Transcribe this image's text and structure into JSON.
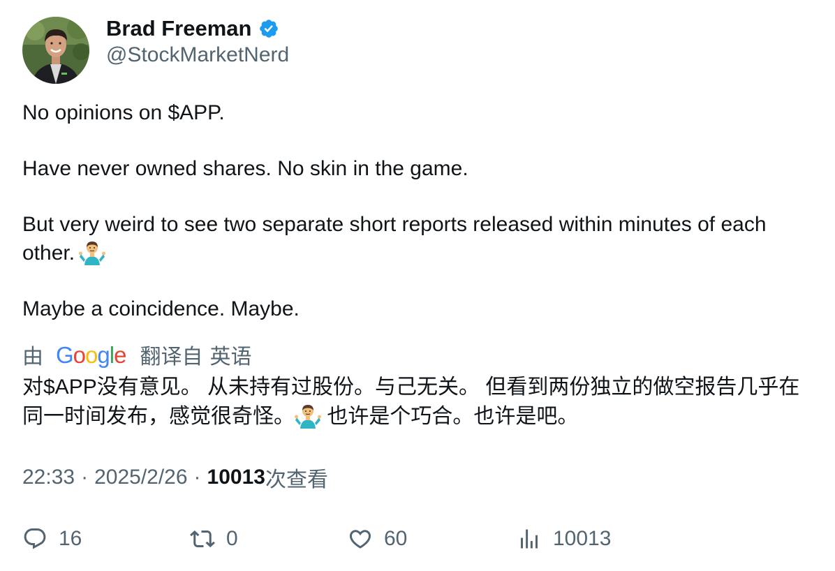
{
  "author": {
    "display_name": "Brad Freeman",
    "handle": "@StockMarketNerd",
    "verified": true,
    "verified_color": "#1d9bf0"
  },
  "tweet": {
    "paragraphs": [
      "No opinions on $APP.",
      "Have never owned shares. No skin in the game.",
      "But very weird to see two separate short reports released within minutes of each other.",
      "Maybe a coincidence. Maybe."
    ],
    "emoji": "person-shrugging"
  },
  "translation": {
    "by_label": "由",
    "provider": "Google",
    "translated_from_label": "翻译自",
    "source_language": "英语",
    "text_before_emoji": "对$APP没有意见。 从未持有过股份。与己无关。 但看到两份独立的做空报告几乎在同一时间发布，感觉很奇怪。",
    "text_after_emoji": " 也许是个巧合。也许是吧。"
  },
  "meta": {
    "time": "22:33",
    "separator": "·",
    "date": "2025/2/26",
    "views_count": "10013",
    "views_label": "次查看"
  },
  "actions": {
    "replies": "16",
    "reposts": "0",
    "likes": "60",
    "views": "10013"
  },
  "colors": {
    "text": "#0f1419",
    "secondary": "#536471",
    "accent": "#1d9bf0",
    "google_blue": "#4285F4",
    "google_red": "#EA4335",
    "google_yellow": "#FBBC05",
    "google_green": "#34A853"
  },
  "icons": {
    "reply": "comment-bubble-icon",
    "repost": "repost-arrows-icon",
    "like": "heart-icon",
    "views": "bar-chart-icon",
    "verified": "verified-badge-icon"
  }
}
